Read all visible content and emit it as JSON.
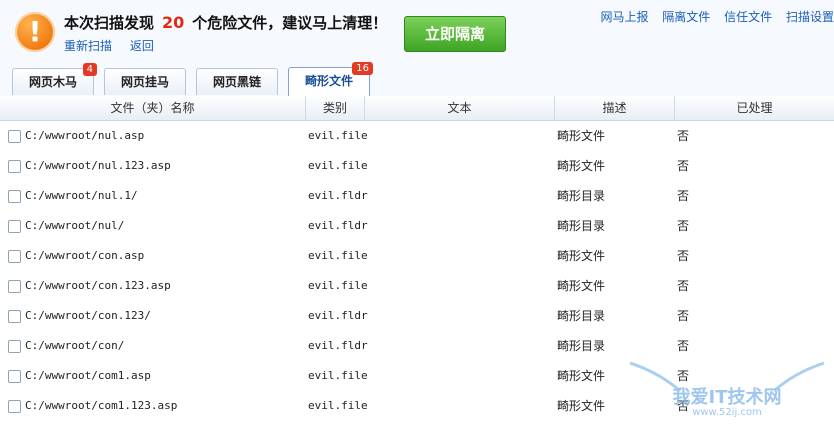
{
  "header": {
    "headline_prefix": "本次扫描发现",
    "danger_count": "20",
    "headline_suffix": "个危险文件，建议马上清理！",
    "rescan_label": "重新扫描",
    "back_label": "返回",
    "isolate_label": "立即隔离",
    "top_links": [
      "网马上报",
      "隔离文件",
      "信任文件",
      "扫描设置"
    ]
  },
  "tabs": [
    {
      "label": "网页木马",
      "badge": "4"
    },
    {
      "label": "网页挂马",
      "badge": ""
    },
    {
      "label": "网页黑链",
      "badge": ""
    },
    {
      "label": "畸形文件",
      "badge": "16"
    }
  ],
  "table": {
    "columns": [
      "文件（夹）名称",
      "类别",
      "文本",
      "描述",
      "已处理"
    ],
    "rows": [
      {
        "path": "C:/wwwroot/nul.asp",
        "type": "evil.file",
        "text": "",
        "desc": "畸形文件",
        "handled": "否"
      },
      {
        "path": "C:/wwwroot/nul.123.asp",
        "type": "evil.file",
        "text": "",
        "desc": "畸形文件",
        "handled": "否"
      },
      {
        "path": "C:/wwwroot/nul.1/",
        "type": "evil.fldr",
        "text": "",
        "desc": "畸形目录",
        "handled": "否"
      },
      {
        "path": "C:/wwwroot/nul/",
        "type": "evil.fldr",
        "text": "",
        "desc": "畸形目录",
        "handled": "否"
      },
      {
        "path": "C:/wwwroot/con.asp",
        "type": "evil.file",
        "text": "",
        "desc": "畸形文件",
        "handled": "否"
      },
      {
        "path": "C:/wwwroot/con.123.asp",
        "type": "evil.file",
        "text": "",
        "desc": "畸形文件",
        "handled": "否"
      },
      {
        "path": "C:/wwwroot/con.123/",
        "type": "evil.fldr",
        "text": "",
        "desc": "畸形目录",
        "handled": "否"
      },
      {
        "path": "C:/wwwroot/con/",
        "type": "evil.fldr",
        "text": "",
        "desc": "畸形目录",
        "handled": "否"
      },
      {
        "path": "C:/wwwroot/com1.asp",
        "type": "evil.file",
        "text": "",
        "desc": "畸形文件",
        "handled": "否"
      },
      {
        "path": "C:/wwwroot/com1.123.asp",
        "type": "evil.file",
        "text": "",
        "desc": "畸形文件",
        "handled": "否"
      }
    ]
  },
  "watermark": {
    "text": "我爱IT技术网",
    "url": "www.52ij.com"
  }
}
